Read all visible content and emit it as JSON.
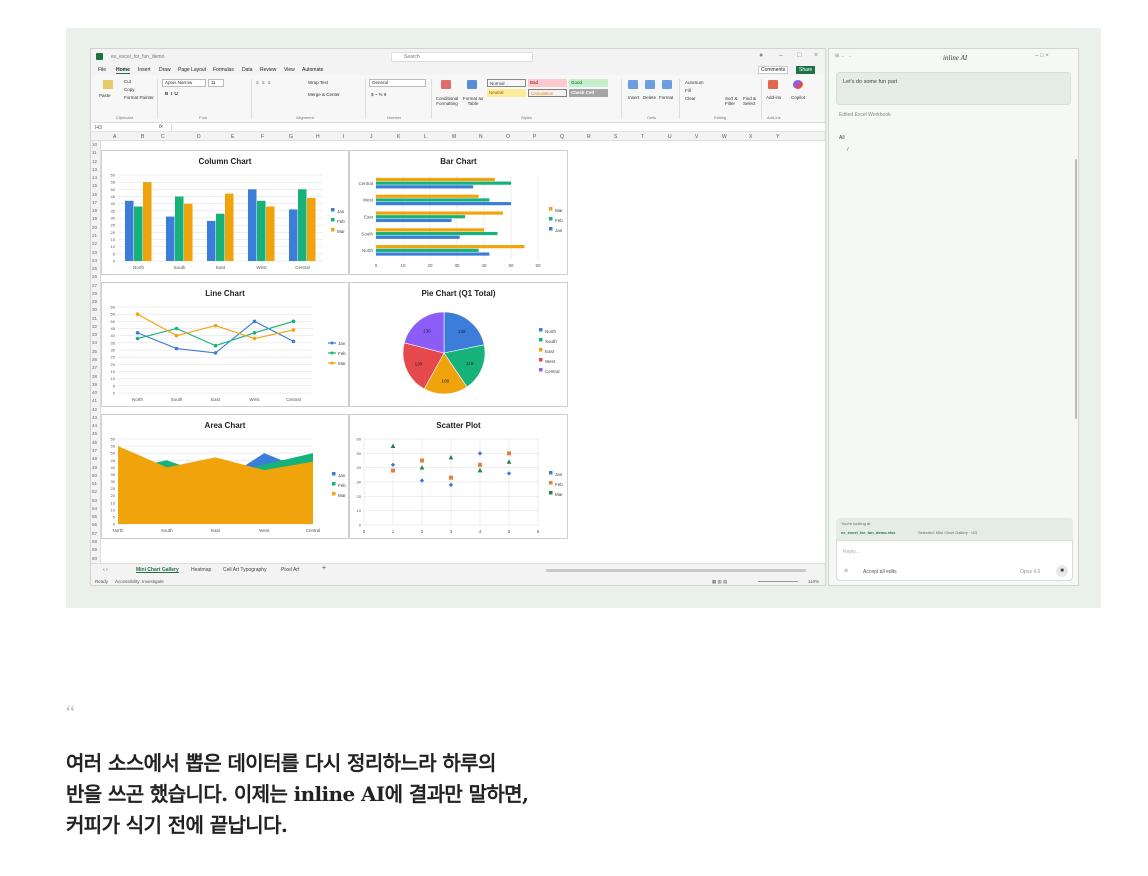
{
  "window": {
    "file_name": "ex_excel_for_fun_demo",
    "search_placeholder": "Search"
  },
  "menu": {
    "tabs": [
      "File",
      "Home",
      "Insert",
      "Draw",
      "Page Layout",
      "Formulas",
      "Data",
      "Review",
      "View",
      "Automate"
    ],
    "comments_label": "Comments",
    "share_label": "Share"
  },
  "ribbon": {
    "paste": "Paste",
    "cut": "Cut",
    "copy": "Copy",
    "format_painter": "Format Painter",
    "font_name": "Aptos Narrow",
    "font_size": "11",
    "wrap_text": "Wrap Text",
    "merge_center": "Merge & Center",
    "number_format": "General",
    "conditional_formatting": "Conditional Formatting",
    "format_as_table": "Format as Table",
    "styles": [
      {
        "label": "Normal",
        "bg": "#ffffff",
        "fg": "#000000"
      },
      {
        "label": "Bad",
        "bg": "#ffc7ce",
        "fg": "#9c0006"
      },
      {
        "label": "Good",
        "bg": "#c6efce",
        "fg": "#006100"
      },
      {
        "label": "Neutral",
        "bg": "#ffeb9c",
        "fg": "#9c5700"
      },
      {
        "label": "Calculation",
        "bg": "#f2f2f2",
        "fg": "#fa7d00"
      },
      {
        "label": "Check Cell",
        "bg": "#a5a5a5",
        "fg": "#ffffff"
      }
    ],
    "insert": "Insert",
    "delete": "Delete",
    "format": "Format",
    "autosum": "AutoSum",
    "fill": "Fill",
    "clear": "Clear",
    "sort_filter": "Sort & Filter",
    "find_select": "Find & Select",
    "addins": "Add-ins",
    "copilot": "Copilot",
    "groups": [
      "Clipboard",
      "Font",
      "Alignment",
      "Number",
      "Styles",
      "Cells",
      "Editing",
      "Add-ins"
    ]
  },
  "formula_bar": {
    "name_box": "I43",
    "fx": "fx"
  },
  "columns": [
    "A",
    "B",
    "C",
    "D",
    "E",
    "F",
    "G",
    "H",
    "I",
    "J",
    "K",
    "L",
    "M",
    "N",
    "O",
    "P",
    "Q",
    "R",
    "S",
    "T",
    "U",
    "V",
    "W",
    "X",
    "Y"
  ],
  "rows": [
    "10",
    "11",
    "12",
    "13",
    "14",
    "15",
    "16",
    "17",
    "18",
    "19",
    "20",
    "21",
    "22",
    "23",
    "24",
    "25",
    "26",
    "27",
    "28",
    "29",
    "30",
    "31",
    "32",
    "33",
    "34",
    "35",
    "36",
    "37",
    "38",
    "39",
    "40",
    "41",
    "42",
    "43",
    "44",
    "45",
    "46",
    "47",
    "48",
    "49",
    "50",
    "51",
    "52",
    "53",
    "54",
    "55",
    "56",
    "57",
    "58",
    "59",
    "60"
  ],
  "sheet_tabs": [
    "Mini Chart Gallery",
    "Heatmap",
    "Cell Art Typography",
    "Pixel Art"
  ],
  "add_sheet": "+",
  "status": {
    "ready": "Ready",
    "accessibility": "Accessibility: Investigate",
    "zoom": "110%"
  },
  "colors": {
    "jan": "#3b7dd8",
    "feb": "#17b27a",
    "mar": "#f0a30a",
    "west": "#e5484d",
    "central": "#8b5cf6",
    "excel_green": "#1e7145"
  },
  "chart_data": [
    {
      "type": "bar",
      "title": "Column Chart",
      "categories": [
        "North",
        "South",
        "East",
        "West",
        "Central"
      ],
      "series": [
        {
          "name": "Jan",
          "values": [
            42,
            31,
            28,
            50,
            36
          ]
        },
        {
          "name": "Feb",
          "values": [
            38,
            45,
            33,
            42,
            50
          ]
        },
        {
          "name": "Mar",
          "values": [
            55,
            40,
            47,
            38,
            44
          ]
        }
      ],
      "ylim": [
        0,
        60
      ],
      "yticks": [
        0,
        5,
        10,
        15,
        20,
        25,
        30,
        35,
        40,
        45,
        50,
        55,
        60
      ],
      "legend": "right",
      "grid": true
    },
    {
      "type": "bar",
      "orientation": "horizontal",
      "title": "Bar Chart",
      "categories": [
        "North",
        "South",
        "East",
        "West",
        "Central"
      ],
      "series": [
        {
          "name": "Jan",
          "values": [
            42,
            31,
            28,
            50,
            36
          ]
        },
        {
          "name": "Feb",
          "values": [
            38,
            45,
            33,
            42,
            50
          ]
        },
        {
          "name": "Mar",
          "values": [
            55,
            40,
            47,
            38,
            44
          ]
        }
      ],
      "xlim": [
        0,
        60
      ],
      "xticks": [
        0,
        10,
        20,
        30,
        40,
        50,
        60
      ],
      "legend": "right",
      "grid": true
    },
    {
      "type": "line",
      "title": "Line Chart",
      "categories": [
        "North",
        "South",
        "East",
        "West",
        "Central"
      ],
      "series": [
        {
          "name": "Jan",
          "values": [
            42,
            31,
            28,
            50,
            36
          ]
        },
        {
          "name": "Feb",
          "values": [
            38,
            45,
            33,
            42,
            50
          ]
        },
        {
          "name": "Mar",
          "values": [
            55,
            40,
            47,
            38,
            44
          ]
        }
      ],
      "ylim": [
        0,
        60
      ],
      "yticks": [
        0,
        5,
        10,
        15,
        20,
        25,
        30,
        35,
        40,
        45,
        50,
        55,
        60
      ],
      "legend": "right",
      "grid": true
    },
    {
      "type": "pie",
      "title": "Pie Chart (Q1 Total)",
      "categories": [
        "North",
        "South",
        "East",
        "West",
        "Central"
      ],
      "values": [
        135,
        116,
        108,
        130,
        130
      ],
      "legend": "right"
    },
    {
      "type": "area",
      "title": "Area Chart",
      "categories": [
        "North",
        "South",
        "East",
        "West",
        "Central"
      ],
      "series": [
        {
          "name": "Jan",
          "values": [
            42,
            31,
            28,
            50,
            36
          ]
        },
        {
          "name": "Feb",
          "values": [
            38,
            45,
            33,
            42,
            50
          ]
        },
        {
          "name": "Mar",
          "values": [
            55,
            40,
            47,
            38,
            44
          ]
        }
      ],
      "ylim": [
        0,
        60
      ],
      "yticks": [
        0,
        5,
        10,
        15,
        20,
        25,
        30,
        35,
        40,
        45,
        50,
        55,
        60
      ],
      "legend": "right",
      "grid": true
    },
    {
      "type": "scatter",
      "title": "Scatter Plot",
      "x": [
        1,
        2,
        3,
        4,
        5
      ],
      "series": [
        {
          "name": "Jan",
          "values": [
            42,
            31,
            28,
            50,
            36
          ]
        },
        {
          "name": "Feb",
          "values": [
            38,
            45,
            33,
            42,
            50
          ]
        },
        {
          "name": "Mar",
          "values": [
            55,
            40,
            47,
            38,
            44
          ]
        }
      ],
      "xlim": [
        0,
        6
      ],
      "xticks": [
        0,
        1,
        2,
        3,
        4,
        5,
        6
      ],
      "ylim": [
        0,
        60
      ],
      "yticks": [
        0,
        10,
        20,
        30,
        40,
        50,
        60
      ],
      "legend": "right",
      "grid": true
    }
  ],
  "panel": {
    "title": "inline AI",
    "user_message": "Let's do some fun part",
    "edited_label": "Edited Excel Workbook",
    "response_text": "All",
    "context_label": "You're looking at",
    "context_file": "ex_excel_for_fun_demo.xlsx",
    "context_selection": "Selected: Mini Chart Gallery · I43",
    "reply_placeholder": "Reply...",
    "accept_all": "Accept all edits",
    "model": "Opus 4.6"
  },
  "testimonial": {
    "quote_mark": "“",
    "lines": [
      "여러 소스에서 뽑은 데이터를 다시 정리하느라 하루의",
      "반을 쓰곤 했습니다. 이제는 inline AI에 결과만 말하면,",
      "커피가 식기 전에 끝납니다."
    ]
  }
}
